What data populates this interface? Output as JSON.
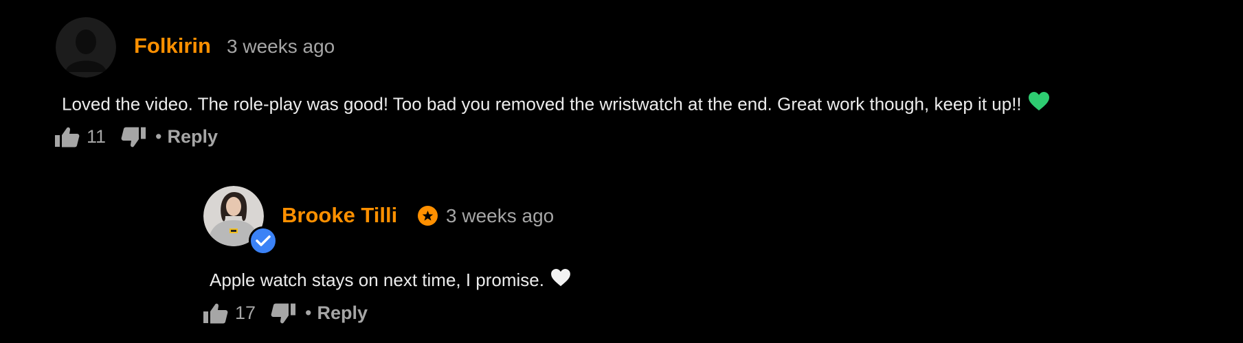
{
  "comments": [
    {
      "author": "Folkirin",
      "time": "3 weeks ago",
      "text": "Loved the video. The role-play was good! Too bad you removed the wristwatch at the end. Great work though, keep it up!!",
      "heart_color": "#2ecc71",
      "likes": "11",
      "reply_label": "Reply",
      "separator": "•"
    },
    {
      "author": "Brooke Tilli",
      "time": "3 weeks ago",
      "text": "Apple watch stays on next time, I promise.",
      "heart_color": "#f2f2f2",
      "likes": "17",
      "reply_label": "Reply",
      "separator": "•",
      "verified": true,
      "badge": "star-badge-icon"
    }
  ],
  "colors": {
    "background": "#000000",
    "username": "#ff9000",
    "meta": "#a6a6a6",
    "verified": "#3b82f6"
  }
}
